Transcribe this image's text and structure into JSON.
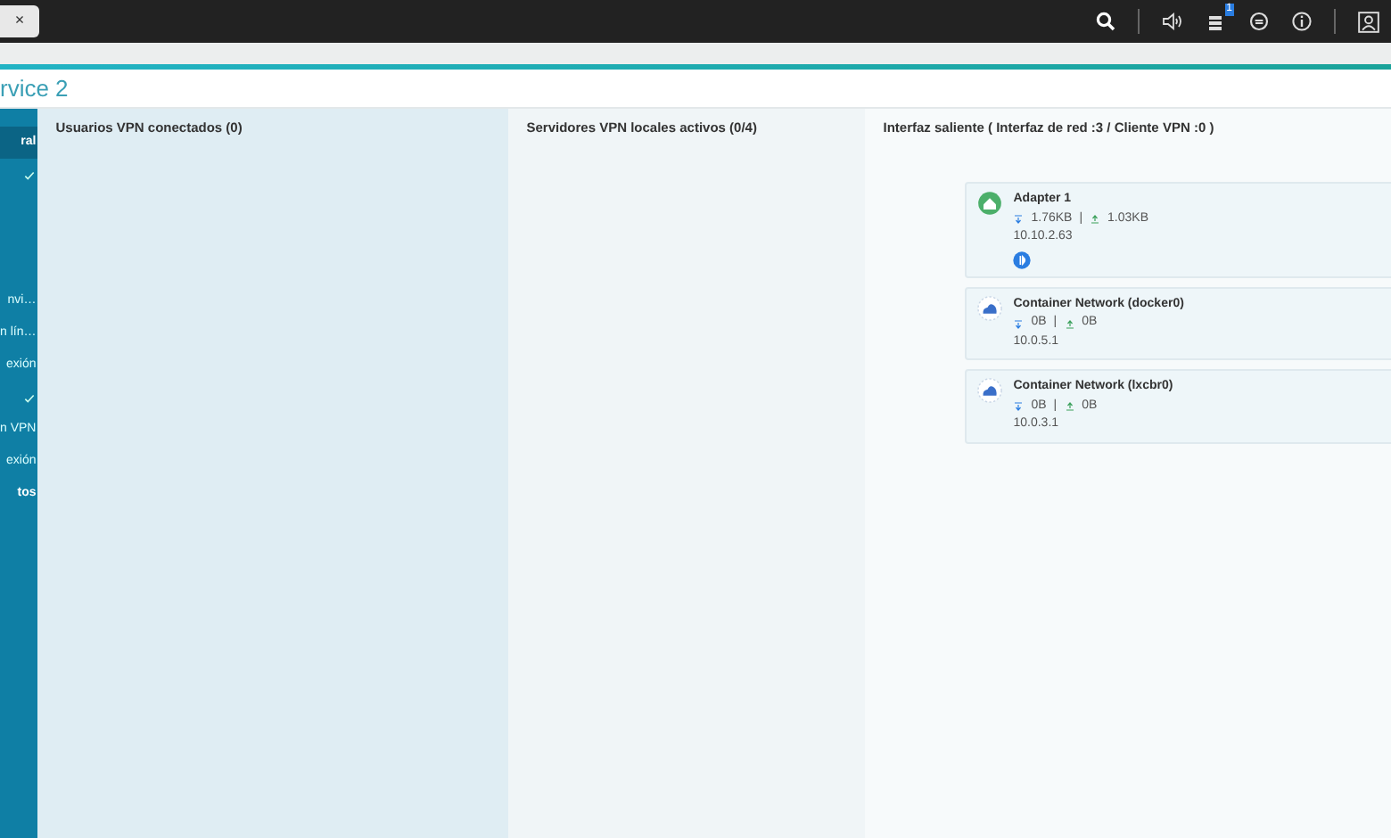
{
  "topbar": {
    "tab_close": "×",
    "notification_badge": "1"
  },
  "page_title": "rvice 2",
  "sidebar": {
    "items": [
      {
        "kind": "text",
        "label": "ral",
        "selected": true
      },
      {
        "kind": "check",
        "selected": false
      },
      {
        "kind": "text",
        "label": "nvi…",
        "selected": false
      },
      {
        "kind": "text",
        "label": "n lín…",
        "selected": false
      },
      {
        "kind": "text",
        "label": "exión",
        "selected": false
      },
      {
        "kind": "check",
        "selected": false
      },
      {
        "kind": "text",
        "label": "n VPN",
        "selected": false
      },
      {
        "kind": "text",
        "label": "exión",
        "selected": false
      },
      {
        "kind": "header",
        "label": "tos",
        "selected": false
      }
    ]
  },
  "panels": [
    {
      "title": "Usuarios VPN conectados (0)"
    },
    {
      "title": "Servidores VPN locales activos (0/4)"
    }
  ],
  "outgoing": {
    "title": "Interfaz saliente ( Interfaz de red :3 / Cliente VPN :0 )",
    "interfaces": [
      {
        "kind": "adapter",
        "name": "Adapter 1",
        "download": "1.76KB",
        "separator": "|",
        "upload": "1.03KB",
        "ip": "10.10.2.63",
        "default_gateway": true
      },
      {
        "kind": "container",
        "name": "Container Network (docker0)",
        "download": "0B",
        "separator": "|",
        "upload": "0B",
        "ip": "10.0.5.1",
        "default_gateway": false
      },
      {
        "kind": "container",
        "name": "Container Network (lxcbr0)",
        "download": "0B",
        "separator": "|",
        "upload": "0B",
        "ip": "10.0.3.1",
        "default_gateway": false
      }
    ]
  }
}
